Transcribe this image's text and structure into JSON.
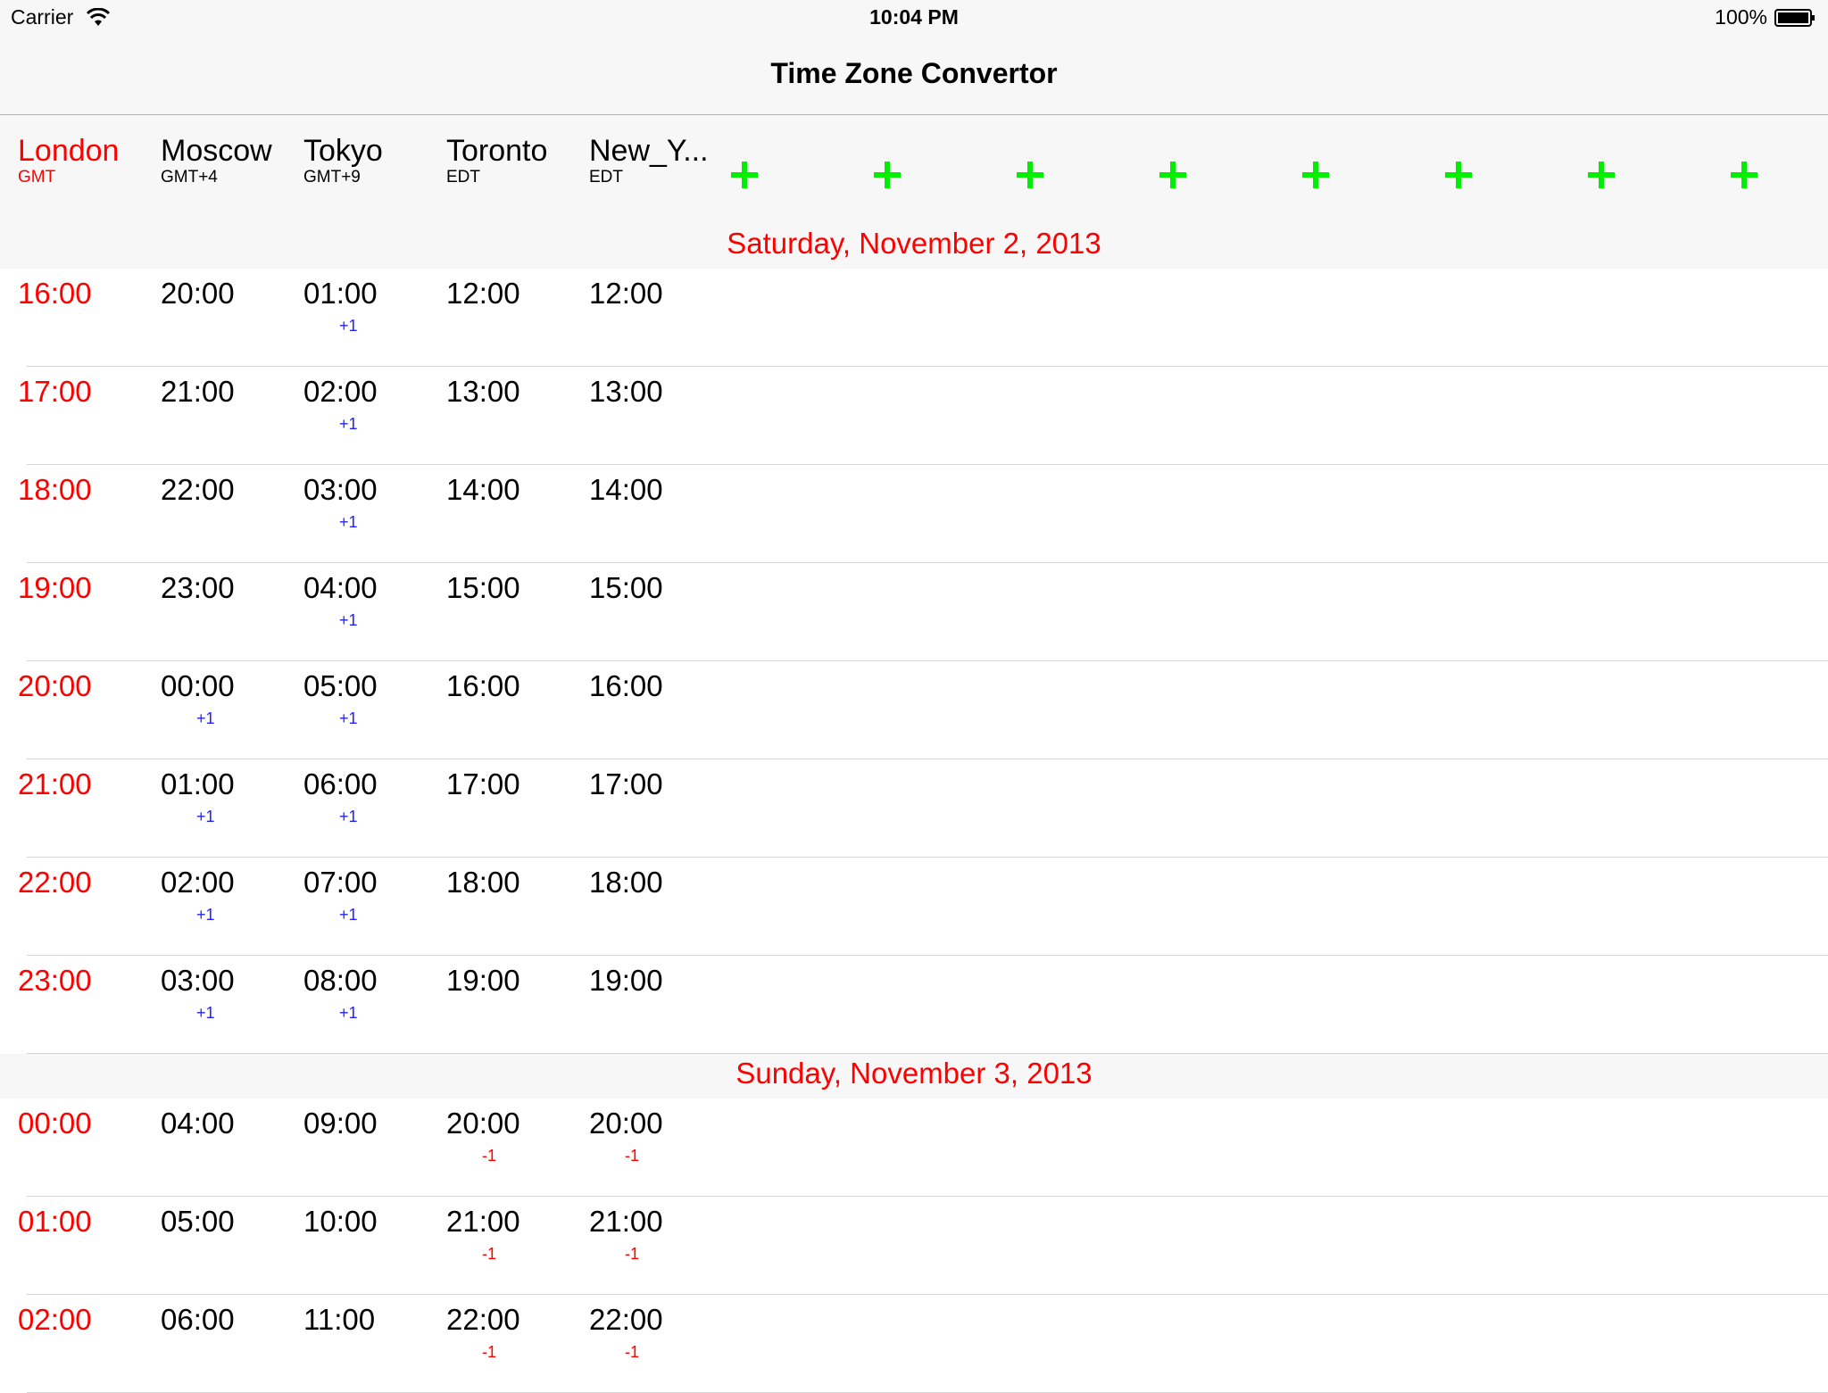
{
  "status_bar": {
    "carrier": "Carrier",
    "time": "10:04 PM",
    "battery": "100%"
  },
  "nav": {
    "title": "Time Zone Convertor"
  },
  "zones": [
    {
      "name": "London",
      "abbr": "GMT",
      "selected": true
    },
    {
      "name": "Moscow",
      "abbr": "GMT+4"
    },
    {
      "name": "Tokyo",
      "abbr": "GMT+9"
    },
    {
      "name": "Toronto",
      "abbr": "EDT"
    },
    {
      "name": "New_Y...",
      "abbr": "EDT"
    }
  ],
  "add_buttons": [
    "+",
    "+",
    "+",
    "+",
    "+",
    "+",
    "+",
    "+"
  ],
  "sections": [
    {
      "title": "Saturday, November 2, 2013",
      "rows": [
        [
          [
            "16:00",
            ""
          ],
          [
            "20:00",
            ""
          ],
          [
            "01:00",
            "+1"
          ],
          [
            "12:00",
            ""
          ],
          [
            "12:00",
            ""
          ]
        ],
        [
          [
            "17:00",
            ""
          ],
          [
            "21:00",
            ""
          ],
          [
            "02:00",
            "+1"
          ],
          [
            "13:00",
            ""
          ],
          [
            "13:00",
            ""
          ]
        ],
        [
          [
            "18:00",
            ""
          ],
          [
            "22:00",
            ""
          ],
          [
            "03:00",
            "+1"
          ],
          [
            "14:00",
            ""
          ],
          [
            "14:00",
            ""
          ]
        ],
        [
          [
            "19:00",
            ""
          ],
          [
            "23:00",
            ""
          ],
          [
            "04:00",
            "+1"
          ],
          [
            "15:00",
            ""
          ],
          [
            "15:00",
            ""
          ]
        ],
        [
          [
            "20:00",
            ""
          ],
          [
            "00:00",
            "+1"
          ],
          [
            "05:00",
            "+1"
          ],
          [
            "16:00",
            ""
          ],
          [
            "16:00",
            ""
          ]
        ],
        [
          [
            "21:00",
            ""
          ],
          [
            "01:00",
            "+1"
          ],
          [
            "06:00",
            "+1"
          ],
          [
            "17:00",
            ""
          ],
          [
            "17:00",
            ""
          ]
        ],
        [
          [
            "22:00",
            ""
          ],
          [
            "02:00",
            "+1"
          ],
          [
            "07:00",
            "+1"
          ],
          [
            "18:00",
            ""
          ],
          [
            "18:00",
            ""
          ]
        ],
        [
          [
            "23:00",
            ""
          ],
          [
            "03:00",
            "+1"
          ],
          [
            "08:00",
            "+1"
          ],
          [
            "19:00",
            ""
          ],
          [
            "19:00",
            ""
          ]
        ]
      ]
    },
    {
      "title": "Sunday, November 3, 2013",
      "rows": [
        [
          [
            "00:00",
            ""
          ],
          [
            "04:00",
            ""
          ],
          [
            "09:00",
            ""
          ],
          [
            "20:00",
            "-1"
          ],
          [
            "20:00",
            "-1"
          ]
        ],
        [
          [
            "01:00",
            ""
          ],
          [
            "05:00",
            ""
          ],
          [
            "10:00",
            ""
          ],
          [
            "21:00",
            "-1"
          ],
          [
            "21:00",
            "-1"
          ]
        ],
        [
          [
            "02:00",
            ""
          ],
          [
            "06:00",
            ""
          ],
          [
            "11:00",
            ""
          ],
          [
            "22:00",
            "-1"
          ],
          [
            "22:00",
            "-1"
          ]
        ]
      ]
    }
  ]
}
